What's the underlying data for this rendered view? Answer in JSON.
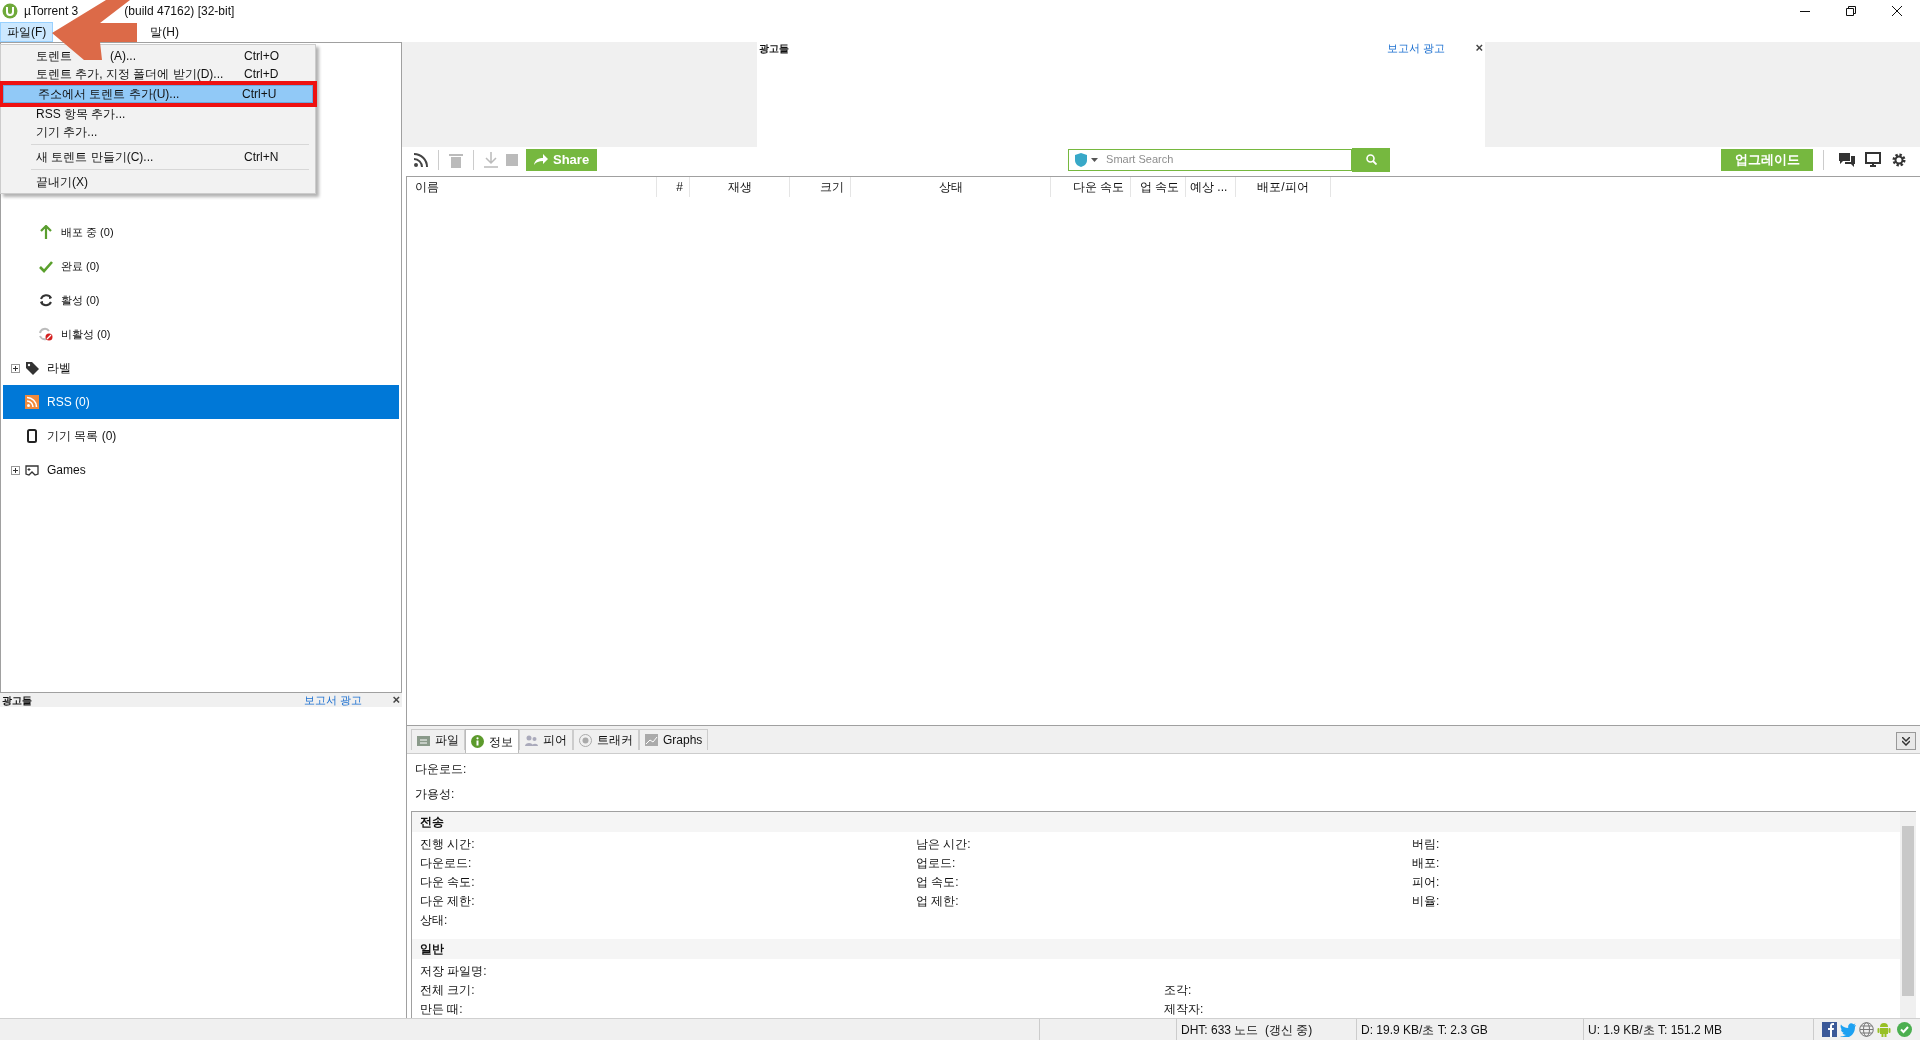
{
  "window": {
    "title_parts": [
      "µTorrent 3",
      "(build 47162) [32-bit]"
    ]
  },
  "menu_bar": [
    {
      "label": "파일(F)",
      "selected": true
    },
    {
      "label": "말(H)",
      "selected": false
    }
  ],
  "file_menu": [
    {
      "kind": "item",
      "label_parts": [
        "토렌트",
        "(A)..."
      ],
      "shortcut": "Ctrl+O",
      "selected": false
    },
    {
      "kind": "item",
      "label_parts": [
        "토렌트 추가, 지정 폴더에 받기(D)..."
      ],
      "shortcut": "Ctrl+D",
      "selected": false
    },
    {
      "kind": "item",
      "label_parts": [
        "주소에서 토렌트 추가(U)..."
      ],
      "shortcut": "Ctrl+U",
      "selected": true
    },
    {
      "kind": "item",
      "label_parts": [
        "RSS 항목 추가..."
      ],
      "selected": false
    },
    {
      "kind": "item",
      "label_parts": [
        "기기 추가..."
      ],
      "selected": false
    },
    {
      "kind": "separator"
    },
    {
      "kind": "item",
      "label_parts": [
        "새 토렌트 만들기(C)..."
      ],
      "shortcut": "Ctrl+N",
      "selected": false
    },
    {
      "kind": "separator"
    },
    {
      "kind": "item",
      "label_parts": [
        "끝내기(X)"
      ],
      "selected": false
    }
  ],
  "sidebar": [
    {
      "label": "배포 중 (0)",
      "kind": "status",
      "selected": false
    },
    {
      "label": "완료 (0)",
      "kind": "status",
      "selected": false
    },
    {
      "label": "활성 (0)",
      "kind": "status",
      "selected": false
    },
    {
      "label": "비활성 (0)",
      "kind": "status",
      "selected": false
    },
    {
      "label": "라벨",
      "kind": "category",
      "collapsed": true,
      "selected": false
    },
    {
      "label": "RSS (0)",
      "kind": "category",
      "selected": true
    },
    {
      "label": "기기 목록 (0)",
      "kind": "category",
      "selected": false
    },
    {
      "label": "Games",
      "kind": "category",
      "collapsed": true,
      "selected": false
    }
  ],
  "sidebar_ad": {
    "label": "광고들",
    "link": "보고서 광고",
    "close": "×"
  },
  "top_ad": {
    "label": "광고들",
    "link": "보고서 광고",
    "close": "×"
  },
  "toolbar": {
    "share": "Share",
    "search_placeholder": "Smart Search",
    "upgrade": "업그레이드"
  },
  "columns": [
    "이름",
    "#",
    "재생",
    "크기",
    "상태",
    "다운 속도",
    "업 속도",
    "예상 ...",
    "배포/피어"
  ],
  "detail_tabs": [
    {
      "label": "파일",
      "selected": false
    },
    {
      "label": "정보",
      "selected": true
    },
    {
      "label": "피어",
      "selected": false
    },
    {
      "label": "트래커",
      "selected": false
    },
    {
      "label": "Graphs",
      "selected": false
    }
  ],
  "info": [
    "다운로드:",
    "가용성:"
  ],
  "sections": [
    {
      "title": "전송",
      "kind": "three_column",
      "rows": [
        [
          "진행 시간:",
          "남은 시간:",
          "버림:"
        ],
        [
          "다운로드:",
          "업로드:",
          "배포:"
        ],
        [
          "다운 속도:",
          "업 속도:",
          "피어:"
        ],
        [
          "다운 제한:",
          "업 제한:",
          "비율:"
        ],
        [
          "상태:"
        ]
      ]
    },
    {
      "title": "일반",
      "kind": "two_column",
      "rows": [
        [
          "저장 파일명:"
        ],
        [
          "전체 크기:",
          "조각:"
        ],
        [
          "만든 때:",
          "제작자:"
        ]
      ]
    }
  ],
  "status_bar": [
    "DHT: 633 노드  (갱신 중)",
    "D: 19.9 KB/초 T: 2.3 GB",
    "U: 1.9 KB/초 T: 151.2 MB"
  ]
}
